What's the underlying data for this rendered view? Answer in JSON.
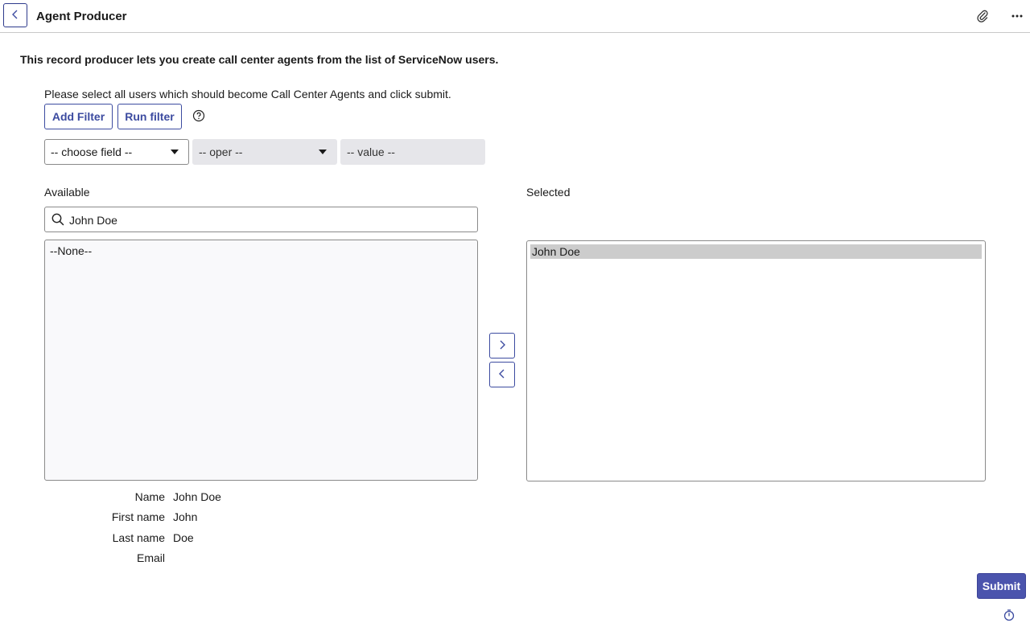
{
  "header": {
    "title": "Agent Producer",
    "back_icon": "chevron-left-icon",
    "attachment_icon": "paperclip-icon",
    "more_icon": "more-horizontal-icon"
  },
  "intro": "This record producer lets you create call center agents from the list of ServiceNow users.",
  "instructions": "Please select all users which should become Call Center Agents and click submit.",
  "filter": {
    "add_filter_label": "Add Filter",
    "run_filter_label": "Run filter",
    "help_icon": "help-circle-icon",
    "field_select": "-- choose field --",
    "operator_select": "-- oper --",
    "value_field": "-- value --"
  },
  "slushbucket": {
    "available_label": "Available",
    "selected_label": "Selected",
    "search_value": "John Doe",
    "search_icon": "search-icon",
    "available_items": [
      "--None--"
    ],
    "selected_items": [
      "John Doe"
    ],
    "move_right_icon": "chevron-right-icon",
    "move_left_icon": "chevron-left-icon"
  },
  "details": [
    {
      "label": "Name",
      "value": "John Doe"
    },
    {
      "label": "First name",
      "value": "John"
    },
    {
      "label": "Last name",
      "value": "Doe"
    },
    {
      "label": "Email",
      "value": ""
    }
  ],
  "submit_label": "Submit",
  "timer_icon": "stopwatch-icon",
  "colors": {
    "accent": "#3c4ba0",
    "submit_bg": "#4b54ad",
    "selected_item_bg": "#cccccc",
    "available_bg": "#f9f9fb",
    "disabled_select_bg": "#e6e6ea"
  }
}
